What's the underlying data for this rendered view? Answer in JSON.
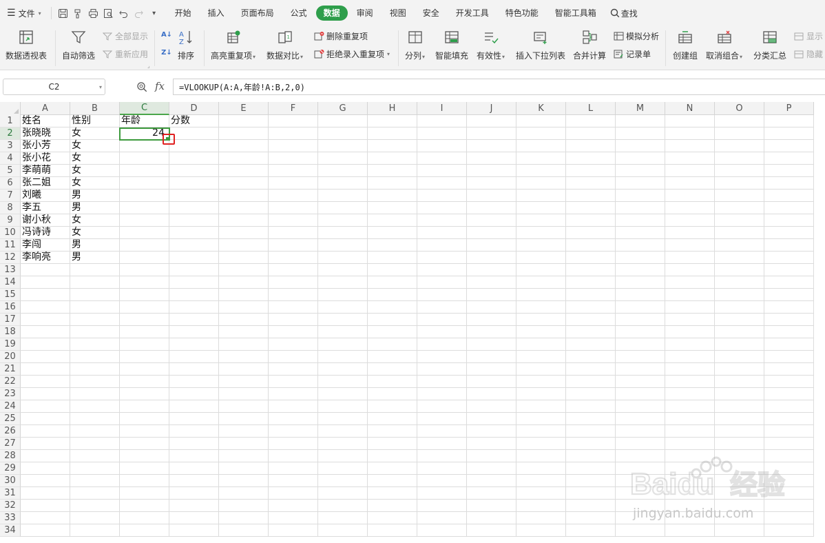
{
  "menu": {
    "file_label": "文件",
    "tabs": [
      {
        "label": "开始",
        "active": false
      },
      {
        "label": "插入",
        "active": false
      },
      {
        "label": "页面布局",
        "active": false
      },
      {
        "label": "公式",
        "active": false
      },
      {
        "label": "数据",
        "active": true
      },
      {
        "label": "审阅",
        "active": false
      },
      {
        "label": "视图",
        "active": false
      },
      {
        "label": "安全",
        "active": false
      },
      {
        "label": "开发工具",
        "active": false
      },
      {
        "label": "特色功能",
        "active": false
      },
      {
        "label": "智能工具箱",
        "active": false
      }
    ],
    "search_label": "查找"
  },
  "ribbon": {
    "pivot": "数据透视表",
    "autofilter": "自动筛选",
    "show_all": "全部显示",
    "reapply": "重新应用",
    "sort": "排序",
    "highlight_dup": "高亮重复项",
    "data_compare": "数据对比",
    "delete_dup": "删除重复项",
    "reject_dup": "拒绝录入重复项",
    "split": "分列",
    "smart_fill": "智能填充",
    "validity": "有效性",
    "insert_dropdown": "插入下拉列表",
    "consolidate": "合并计算",
    "simulate": "模拟分析",
    "record": "记录单",
    "create_group": "创建组",
    "ungroup": "取消组合",
    "subtotal": "分类汇总",
    "show_detail": "显示",
    "hide_detail": "隐藏"
  },
  "formula_bar": {
    "name_box": "C2",
    "fx": "fx",
    "formula": "=VLOOKUP(A:A,年龄!A:B,2,0)"
  },
  "sheet": {
    "columns": [
      "A",
      "B",
      "C",
      "D",
      "E",
      "F",
      "G",
      "H",
      "I",
      "J",
      "K",
      "L",
      "M",
      "N",
      "O",
      "P"
    ],
    "selected_column": "C",
    "selected_row": 2,
    "row_count": 34,
    "cells": [
      [
        "姓名",
        "性别",
        "年龄",
        "分数"
      ],
      [
        "张晓晓",
        "女",
        "24",
        ""
      ],
      [
        "张小芳",
        "女",
        "",
        ""
      ],
      [
        "张小花",
        "女",
        "",
        ""
      ],
      [
        "李萌萌",
        "女",
        "",
        ""
      ],
      [
        "张二姐",
        "女",
        "",
        ""
      ],
      [
        "刘曦",
        "男",
        "",
        ""
      ],
      [
        "李五",
        "男",
        "",
        ""
      ],
      [
        "谢小秋",
        "女",
        "",
        ""
      ],
      [
        "冯诗诗",
        "女",
        "",
        ""
      ],
      [
        "李闯",
        "男",
        "",
        ""
      ],
      [
        "李响亮",
        "男",
        "",
        ""
      ]
    ]
  },
  "watermark": {
    "brand": "Baidu",
    "brand_cn": "经验",
    "url": "jingyan.baidu.com"
  },
  "colors": {
    "accent_green": "#2e9e4b",
    "selection_green": "#3d9a3d",
    "marker_red": "#e02020"
  }
}
